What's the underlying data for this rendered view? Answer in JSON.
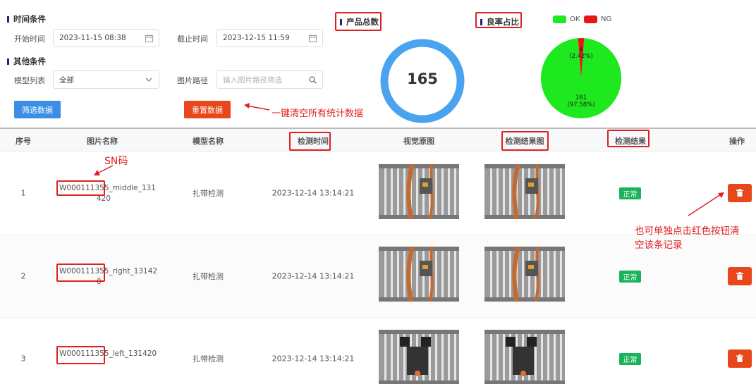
{
  "filters": {
    "time_section_title": "时间条件",
    "start_label": "开始时间",
    "start_value": "2023-11-15 08:38",
    "end_label": "截止时间",
    "end_value": "2023-12-15 11:59",
    "other_section_title": "其他条件",
    "model_label": "模型列表",
    "model_value": "全部",
    "path_label": "图片路径",
    "path_placeholder": "输入图片路径筛选",
    "filter_button": "筛选数据",
    "reset_button": "重置数据"
  },
  "stats": {
    "total_title": "产品总数",
    "total_value": "165",
    "ratio_title": "良率占比",
    "legend": [
      {
        "name": "OK",
        "color": "#1ee81e"
      },
      {
        "name": "NG",
        "color": "#e81515"
      }
    ],
    "pie_labels": {
      "ng_count": "4",
      "ng_pct": "(2.42%)",
      "ok_count": "161",
      "ok_pct": "(97.58%)"
    }
  },
  "chart_data": [
    {
      "type": "pie",
      "title": "良率占比",
      "categories": [
        "OK",
        "NG"
      ],
      "values": [
        161,
        4
      ],
      "percentages": [
        97.58,
        2.42
      ],
      "colors": [
        "#1ee81e",
        "#e81515"
      ],
      "legend": "top"
    }
  ],
  "annotations": {
    "reset_note": "一键清空所有统计数据",
    "sn_note": "SN码",
    "delete_note_line1": "也可单独点击红色按钮清",
    "delete_note_line2": "空该条记录"
  },
  "table": {
    "headers": [
      "序号",
      "图片名称",
      "模型名称",
      "检测时间",
      "视觉原图",
      "检测结果图",
      "检测结果",
      "操作"
    ],
    "rows": [
      {
        "index": "1",
        "sn": "W000111355",
        "name_rest_line1": "_middle_131",
        "name_rest_line2": "420",
        "model": "扎带检测",
        "time": "2023-12-14 13:14:21",
        "result": "正常"
      },
      {
        "index": "2",
        "sn": "W000111355",
        "name_rest_line1": "_right_13142",
        "name_rest_line2": "0",
        "model": "扎带检测",
        "time": "2023-12-14 13:14:21",
        "result": "正常"
      },
      {
        "index": "3",
        "sn": "W000111355",
        "name_rest_line1": "_left_131420",
        "name_rest_line2": "",
        "model": "扎带检测",
        "time": "2023-12-14 13:14:21",
        "result": "正常"
      }
    ]
  }
}
